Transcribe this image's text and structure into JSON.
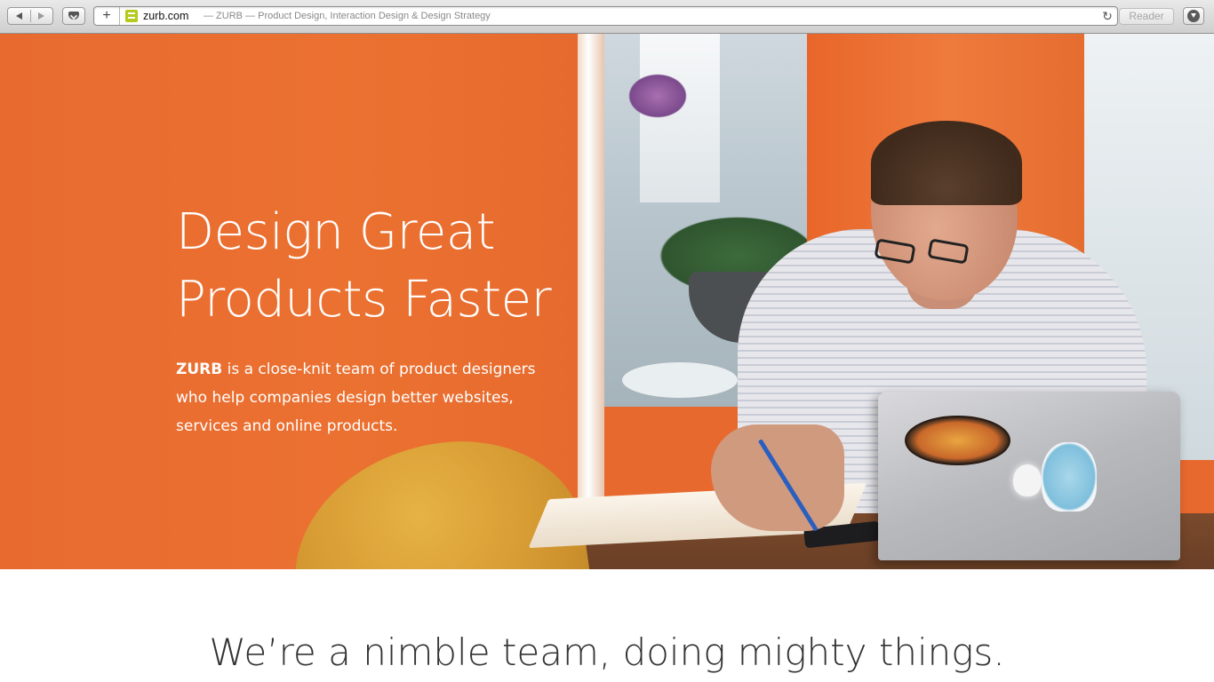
{
  "browser": {
    "url": "zurb.com",
    "page_title": "— ZURB — Product Design, Interaction Design & Design Strategy",
    "reader_label": "Reader",
    "add_tab_label": "+",
    "reload_glyph": "↻",
    "icons": {
      "back": "back-arrow-icon",
      "forward": "forward-arrow-icon",
      "reading_list": "pocket-icon",
      "favicon": "zurb-favicon-icon",
      "reload": "reload-icon",
      "downloads": "download-icon"
    }
  },
  "hero": {
    "headline_line1": "Design Great",
    "headline_line2": "Products Faster",
    "brand": "ZURB",
    "description": " is a close-knit team of product designers who help companies design better websites, services and online products.",
    "background_color": "#e8692e"
  },
  "section": {
    "tagline": "We’re a nimble team, doing mighty things."
  },
  "colors": {
    "accent_orange": "#e8692e",
    "text_dark": "#333333",
    "favicon_green": "#b6c91c"
  }
}
